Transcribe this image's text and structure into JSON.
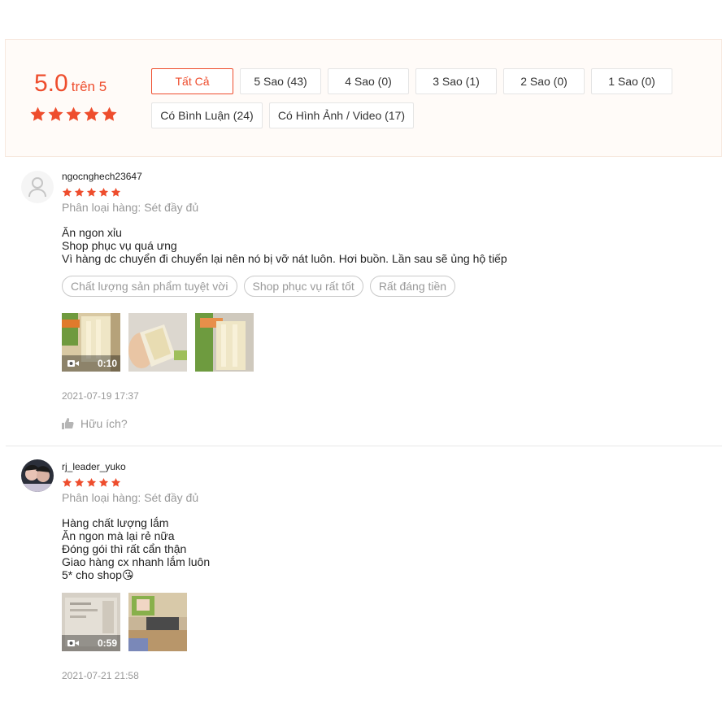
{
  "summary": {
    "score": "5.0",
    "score_suffix": "trên 5",
    "filters": [
      {
        "label": "Tất Cả"
      },
      {
        "label": "5 Sao (43)"
      },
      {
        "label": "4 Sao (0)"
      },
      {
        "label": "3 Sao (1)"
      },
      {
        "label": "2 Sao (0)"
      },
      {
        "label": "1 Sao (0)"
      },
      {
        "label": "Có Bình Luận (24)"
      },
      {
        "label": "Có Hình Ảnh / Video (17)"
      }
    ]
  },
  "colors": {
    "accent": "#ee4d2d",
    "muted": "#999999"
  },
  "reviews": [
    {
      "username": "ngocnghech23647",
      "rating": 5,
      "variant": "Phân loại hàng: Sét đầy đủ",
      "lines": [
        "Ăn ngon xỉu",
        "Shop phục vụ quá ưng",
        "Vì hàng dc chuyển đi chuyển lại nên nó bị vỡ nát luôn. Hơi buồn. Lần sau sẽ ủng hộ tiếp"
      ],
      "tags": [
        "Chất lượng sản phẩm tuyệt vời",
        "Shop phục vụ rất tốt",
        "Rất đáng tiền"
      ],
      "video_duration": "0:10",
      "timestamp": "2021-07-19 17:37",
      "helpful_label": "Hữu ích?"
    },
    {
      "username": "rj_leader_yuko",
      "rating": 5,
      "variant": "Phân loại hàng: Sét đầy đủ",
      "lines": [
        "Hàng chất lượng lắm",
        "Ăn ngon mà lại rẻ nữa",
        "Đóng gói thì rất cẩn thận",
        "Giao hàng cx nhanh lắm luôn",
        "5* cho shop"
      ],
      "emoji": "😘",
      "video_duration": "0:59",
      "timestamp": "2021-07-21 21:58"
    }
  ]
}
